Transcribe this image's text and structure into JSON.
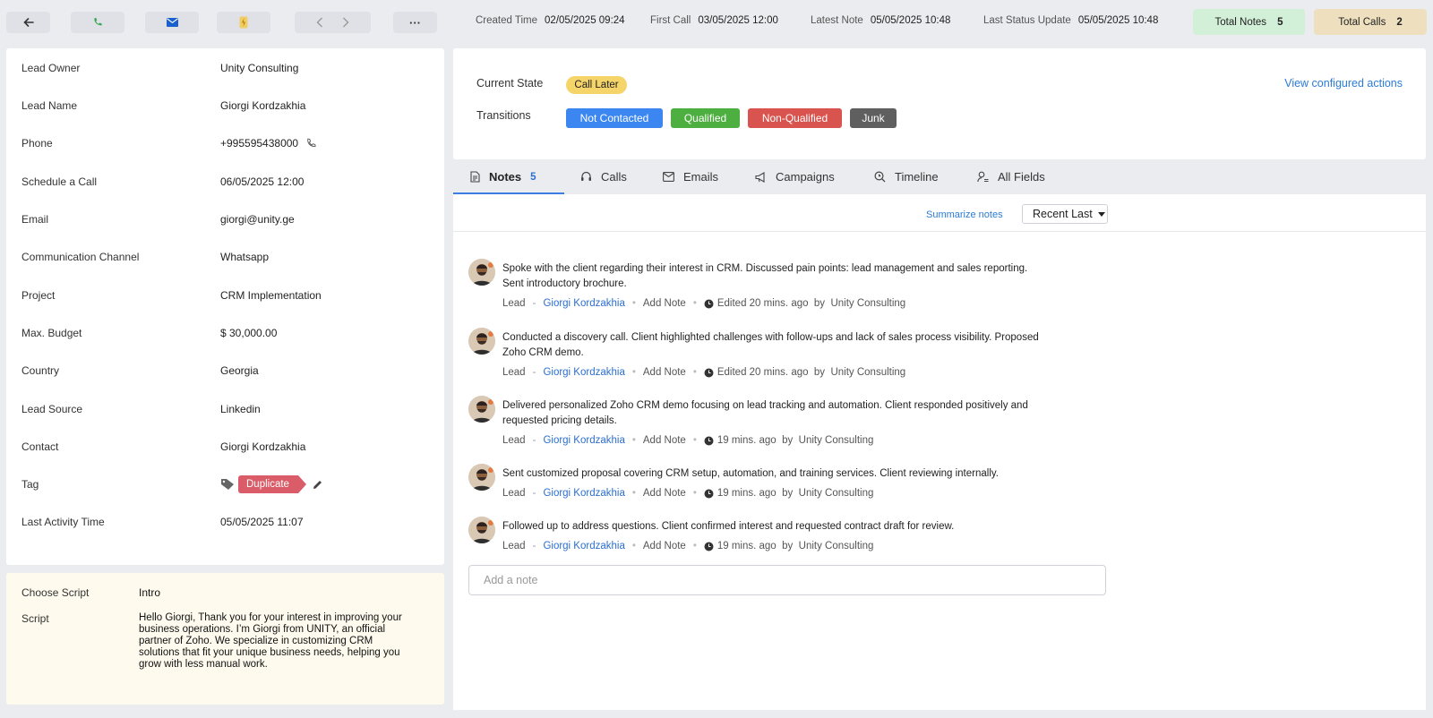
{
  "header": {
    "created_label": "Created Time",
    "created_value": "02/05/2025 09:24",
    "first_call_label": "First Call",
    "first_call_value": "03/05/2025 12:00",
    "latest_note_label": "Latest Note",
    "latest_note_value": "05/05/2025 10:48",
    "last_status_label": "Last Status Update",
    "last_status_value": "05/05/2025 10:48",
    "total_notes_label": "Total Notes",
    "total_notes_value": "5",
    "total_calls_label": "Total Calls",
    "total_calls_value": "2",
    "more_label": "···",
    "colors": {
      "notes_bg": "#d2efd7",
      "calls_bg": "#eedfbe",
      "call_icon": "#3aa757",
      "mail_icon": "#1a5fd0",
      "bolt_icon": "#e3b64a"
    }
  },
  "details": [
    {
      "label": "Lead Owner",
      "value": "Unity Consulting"
    },
    {
      "label": "Lead Name",
      "value": "Giorgi Kordzakhia"
    },
    {
      "label": "Phone",
      "value": "+995595438000"
    },
    {
      "label": "Schedule a Call",
      "value": "06/05/2025 12:00"
    },
    {
      "label": "Email",
      "value": "giorgi@unity.ge"
    },
    {
      "label": "Communication Channel",
      "value": "Whatsapp"
    },
    {
      "label": "Project",
      "value": "CRM Implementation"
    },
    {
      "label": "Max. Budget",
      "value": "$ 30,000.00"
    },
    {
      "label": "Country",
      "value": "Georgia"
    },
    {
      "label": "Lead Source",
      "value": "Linkedin"
    },
    {
      "label": "Contact",
      "value": "Giorgi Kordzakhia"
    },
    {
      "label": "Tag",
      "value": "Duplicate"
    },
    {
      "label": "Last Activity Time",
      "value": "05/05/2025 11:07"
    }
  ],
  "script": {
    "choose_label": "Choose Script",
    "choose_value": "Intro",
    "script_label": "Script",
    "script_text": "Hello Giorgi, Thank you for your interest in improving your business operations. I’m Giorgi from UNITY, an official partner of Zoho. We specialize in customizing CRM solutions that fit your unique business needs, helping you grow with less manual work."
  },
  "state": {
    "current_label": "Current State",
    "current_value": "Call Later",
    "transitions_label": "Transitions",
    "transitions": [
      {
        "label": "Not Contacted",
        "color": "#3b86f0"
      },
      {
        "label": "Qualified",
        "color": "#4caf3f"
      },
      {
        "label": "Non-Qualified",
        "color": "#d9534f"
      },
      {
        "label": "Junk",
        "color": "#5f5f5f"
      }
    ],
    "current_color": "#f5d46a",
    "view_actions": "View configured actions"
  },
  "tabs": [
    {
      "label": "Notes",
      "count": "5"
    },
    {
      "label": "Calls"
    },
    {
      "label": "Emails"
    },
    {
      "label": "Campaigns"
    },
    {
      "label": "Timeline"
    },
    {
      "label": "All Fields"
    }
  ],
  "notes_panel": {
    "summarize": "Summarize notes",
    "sort": "Recent Last",
    "add_placeholder": "Add a note",
    "notes": [
      {
        "text": "Spoke with the client regarding their interest in CRM. Discussed pain points: lead management and sales reporting. Sent introductory brochure.",
        "module": "Lead",
        "contact": "Giorgi Kordzakhia",
        "add": "Add Note",
        "time": "Edited 20 mins. ago",
        "by": "by",
        "owner": "Unity Consulting"
      },
      {
        "text": "Conducted a discovery call. Client highlighted challenges with follow-ups and lack of sales process visibility. Proposed Zoho CRM demo.",
        "module": "Lead",
        "contact": "Giorgi Kordzakhia",
        "add": "Add Note",
        "time": "Edited 20 mins. ago",
        "by": "by",
        "owner": "Unity Consulting"
      },
      {
        "text": "Delivered personalized Zoho CRM demo focusing on lead tracking and automation. Client responded positively and requested pricing details.",
        "module": "Lead",
        "contact": "Giorgi Kordzakhia",
        "add": "Add Note",
        "time": "19 mins. ago",
        "by": "by",
        "owner": "Unity Consulting"
      },
      {
        "text": "Sent customized proposal covering CRM setup, automation, and training services. Client reviewing internally.",
        "module": "Lead",
        "contact": "Giorgi Kordzakhia",
        "add": "Add Note",
        "time": "19 mins. ago",
        "by": "by",
        "owner": "Unity Consulting"
      },
      {
        "text": "Followed up to address questions. Client confirmed interest and requested contract draft for review.",
        "module": "Lead",
        "contact": "Giorgi Kordzakhia",
        "add": "Add Note",
        "time": "19 mins. ago",
        "by": "by",
        "owner": "Unity Consulting"
      }
    ]
  }
}
